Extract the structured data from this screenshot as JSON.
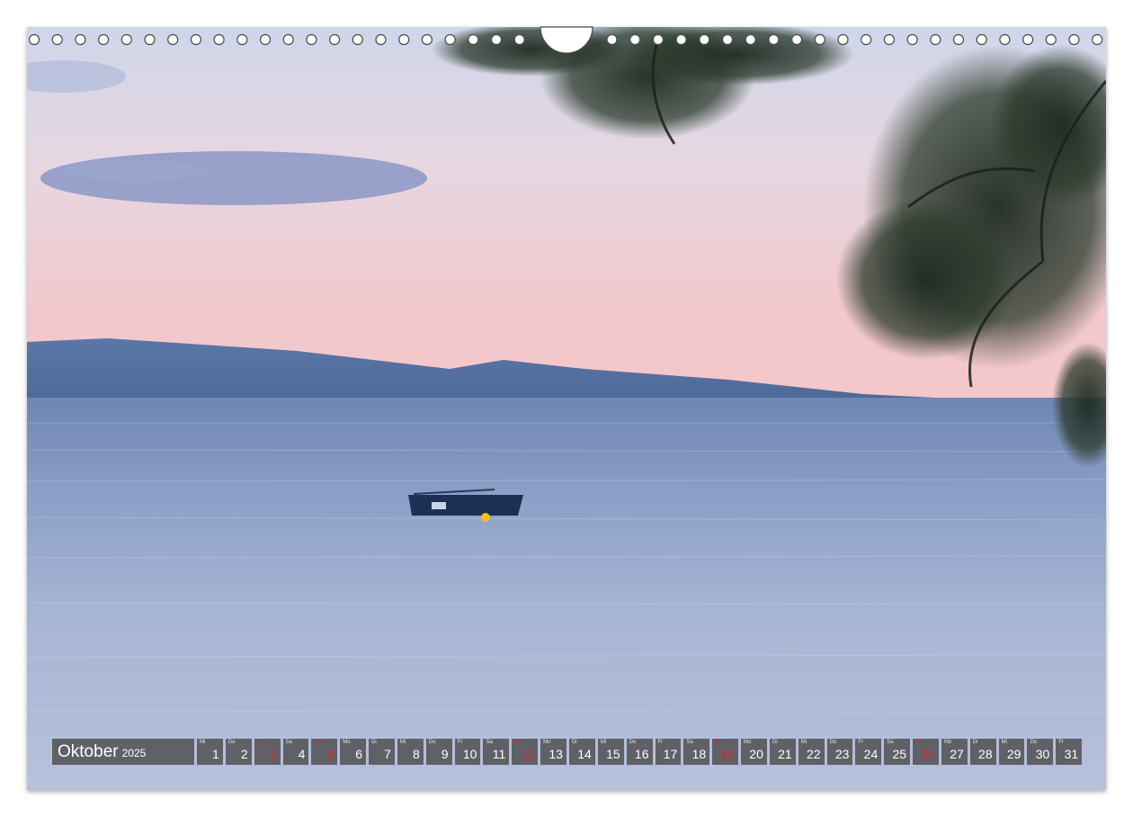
{
  "calendar": {
    "month": "Oktober",
    "year": "2025",
    "days": [
      {
        "abbr": "Mi",
        "num": "1",
        "red": false
      },
      {
        "abbr": "Do",
        "num": "2",
        "red": false
      },
      {
        "abbr": "Fr",
        "num": "3",
        "red": true
      },
      {
        "abbr": "Sa",
        "num": "4",
        "red": false
      },
      {
        "abbr": "So",
        "num": "5",
        "red": true
      },
      {
        "abbr": "Mo",
        "num": "6",
        "red": false
      },
      {
        "abbr": "Di",
        "num": "7",
        "red": false
      },
      {
        "abbr": "Mi",
        "num": "8",
        "red": false
      },
      {
        "abbr": "Do",
        "num": "9",
        "red": false
      },
      {
        "abbr": "Fr",
        "num": "10",
        "red": false
      },
      {
        "abbr": "Sa",
        "num": "11",
        "red": false
      },
      {
        "abbr": "So",
        "num": "12",
        "red": true
      },
      {
        "abbr": "Mo",
        "num": "13",
        "red": false
      },
      {
        "abbr": "Di",
        "num": "14",
        "red": false
      },
      {
        "abbr": "Mi",
        "num": "15",
        "red": false
      },
      {
        "abbr": "Do",
        "num": "16",
        "red": false
      },
      {
        "abbr": "Fr",
        "num": "17",
        "red": false
      },
      {
        "abbr": "Sa",
        "num": "18",
        "red": false
      },
      {
        "abbr": "So",
        "num": "19",
        "red": true
      },
      {
        "abbr": "Mo",
        "num": "20",
        "red": false
      },
      {
        "abbr": "Di",
        "num": "21",
        "red": false
      },
      {
        "abbr": "Mi",
        "num": "22",
        "red": false
      },
      {
        "abbr": "Do",
        "num": "23",
        "red": false
      },
      {
        "abbr": "Fr",
        "num": "24",
        "red": false
      },
      {
        "abbr": "Sa",
        "num": "25",
        "red": false
      },
      {
        "abbr": "So",
        "num": "26",
        "red": true
      },
      {
        "abbr": "Mo",
        "num": "27",
        "red": false
      },
      {
        "abbr": "Di",
        "num": "28",
        "red": false
      },
      {
        "abbr": "Mi",
        "num": "29",
        "red": false
      },
      {
        "abbr": "Do",
        "num": "30",
        "red": false
      },
      {
        "abbr": "Fr",
        "num": "31",
        "red": false
      }
    ]
  },
  "colors": {
    "sky_top": "#cfd6ea",
    "sky_pink": "#f2c6cc",
    "mountain": "#5a77a8",
    "sea": "#9fb0cf",
    "boat": "#1e2f55",
    "calendar_bg": "#464646",
    "sunday_red": "#d9262b"
  },
  "icons": {
    "binding": "wire-binding-rings",
    "boat": "rowing-boat",
    "tree": "pine-branches"
  }
}
